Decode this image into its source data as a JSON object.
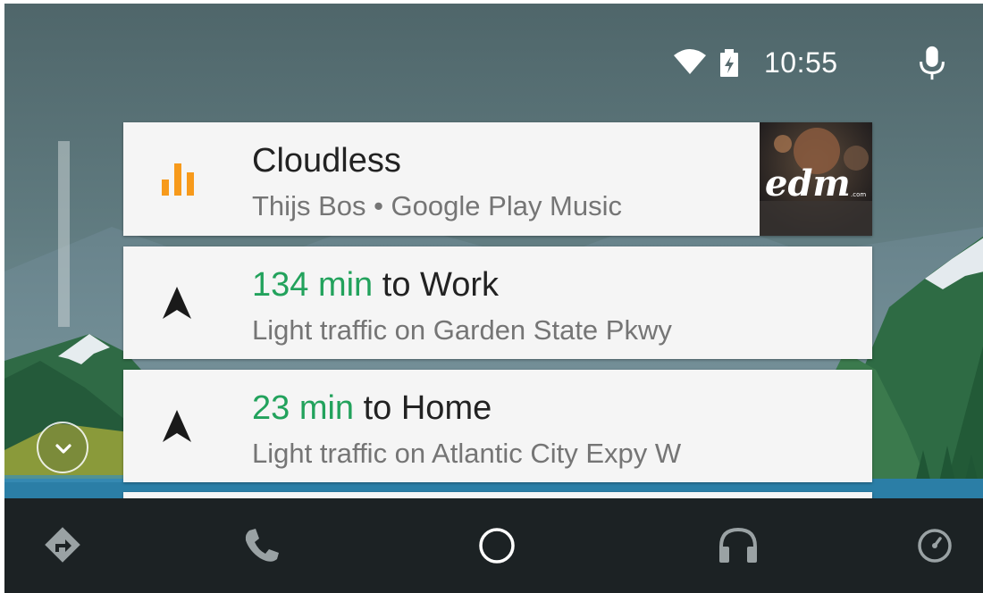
{
  "status": {
    "time": "10:55",
    "wifi_icon": "wifi-icon",
    "battery_icon": "battery-charging-icon",
    "mic_icon": "microphone-icon"
  },
  "cards": {
    "music": {
      "icon": "equalizer-icon",
      "title": "Cloudless",
      "subtitle": "Thijs Bos • Google Play Music",
      "art_text": "edm",
      "art_suffix": ".com"
    },
    "work": {
      "icon": "navigation-arrow-icon",
      "time": "134 min",
      "destination": " to Work",
      "subtitle": "Light traffic on Garden State Pkwy"
    },
    "home": {
      "icon": "navigation-arrow-icon",
      "time": "23 min",
      "destination": " to Home",
      "subtitle": "Light traffic on Atlantic City Expy W"
    }
  },
  "nav": {
    "items": [
      "directions-icon",
      "phone-icon",
      "home-circle-icon",
      "headphones-icon",
      "exit-icon"
    ]
  },
  "colors": {
    "accent_green": "#22a25c",
    "music_orange": "#f79a1b",
    "bottom_bar": "#1c2224"
  }
}
